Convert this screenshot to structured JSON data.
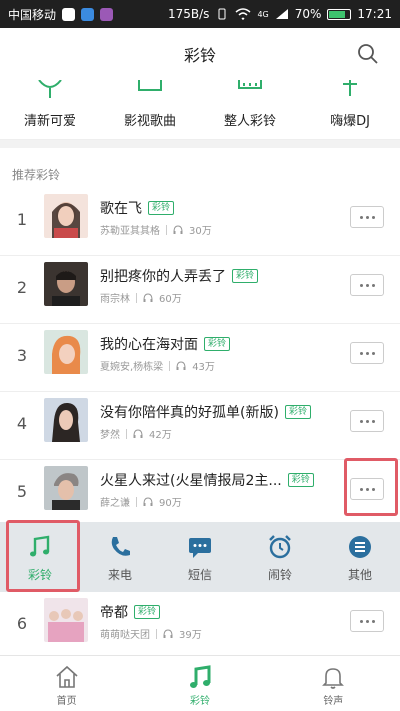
{
  "status_bar": {
    "carrier": "中国移动",
    "speed": "175B/s",
    "network": "4G",
    "battery": "70%",
    "time": "17:21"
  },
  "header": {
    "title": "彩铃"
  },
  "categories": [
    {
      "label": "清新可爱"
    },
    {
      "label": "影视歌曲"
    },
    {
      "label": "整人彩铃"
    },
    {
      "label": "嗨爆DJ"
    }
  ],
  "section": {
    "title": "推荐彩铃"
  },
  "songs": [
    {
      "rank": "1",
      "title": "歌在飞",
      "tag": "彩铃",
      "artist": "苏勒亚其其格",
      "plays": "30万"
    },
    {
      "rank": "2",
      "title": "别把疼你的人弄丢了",
      "tag": "彩铃",
      "artist": "雨宗林",
      "plays": "60万"
    },
    {
      "rank": "3",
      "title": "我的心在海对面",
      "tag": "彩铃",
      "artist": "夏婉安,杨栋梁",
      "plays": "43万"
    },
    {
      "rank": "4",
      "title": "没有你陪伴真的好孤单(新版)",
      "tag": "彩铃",
      "artist": "梦然",
      "plays": "42万"
    },
    {
      "rank": "5",
      "title": "火星人来过(火星情报局2主...",
      "tag": "彩铃",
      "artist": "薛之谦",
      "plays": "90万"
    },
    {
      "rank": "6",
      "title": "帝都",
      "tag": "彩铃",
      "artist": "萌萌哒天团",
      "plays": "39万"
    }
  ],
  "action_bar": [
    {
      "label": "彩铃",
      "icon": "music-note-icon"
    },
    {
      "label": "来电",
      "icon": "phone-icon"
    },
    {
      "label": "短信",
      "icon": "message-icon"
    },
    {
      "label": "闹铃",
      "icon": "alarm-clock-icon"
    },
    {
      "label": "其他",
      "icon": "menu-icon"
    }
  ],
  "bottom_nav": [
    {
      "label": "首页",
      "icon": "home-icon"
    },
    {
      "label": "彩铃",
      "icon": "music-note-icon"
    },
    {
      "label": "铃声",
      "icon": "bell-icon"
    }
  ],
  "colors": {
    "accent": "#2fae6b",
    "highlight": "#e05b66",
    "status_bar": "#202020",
    "action_bar": "#e3e7ea"
  }
}
